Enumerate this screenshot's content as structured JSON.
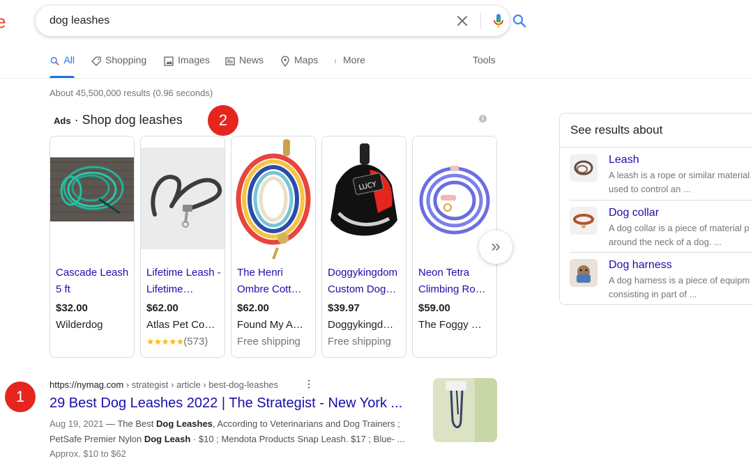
{
  "search": {
    "query": "dog leashes"
  },
  "tabs": [
    {
      "label": "All",
      "icon": "search-icon",
      "active": true
    },
    {
      "label": "Shopping",
      "icon": "tag-icon"
    },
    {
      "label": "Images",
      "icon": "image-icon"
    },
    {
      "label": "News",
      "icon": "news-icon"
    },
    {
      "label": "Maps",
      "icon": "map-pin-icon"
    },
    {
      "label": "More",
      "icon": "more-vert-icon"
    }
  ],
  "tools_label": "Tools",
  "result_stats": "About 45,500,000 results (0.96 seconds)",
  "ads": {
    "label": "Ads",
    "separator": "·",
    "title": "Shop dog leashes",
    "info_glyph": "i",
    "products": [
      {
        "title": "Cascade Leash 5 ft",
        "price": "$32.00",
        "merchant": "Wilderdog",
        "extra": ""
      },
      {
        "title": "Lifetime Leash - Lifetime…",
        "price": "$62.00",
        "merchant": "Atlas Pet Co…",
        "stars": "★★★★★",
        "extra": "(573)"
      },
      {
        "title": "The Henri Ombre Cott…",
        "price": "$62.00",
        "merchant": "Found My A…",
        "extra": "Free shipping"
      },
      {
        "title": "Doggykingdom Custom Dog…",
        "price": "$39.97",
        "merchant": "Doggykingd…",
        "extra": "Free shipping"
      },
      {
        "title": "Neon Tetra Climbing Ro…",
        "price": "$59.00",
        "merchant": "The Foggy …",
        "extra": ""
      }
    ],
    "next_glyph": "»"
  },
  "badges": {
    "one": "1",
    "two": "2"
  },
  "organic": {
    "site": "https://nymag.com",
    "path": " › strategist › article › best-dog-leashes",
    "menu_glyph": "⋮",
    "title": "29 Best Dog Leashes 2022 | The Strategist - New York ...",
    "snippet_date": "Aug 19, 2021",
    "snippet_dash": " — ",
    "snippet_1": "The Best ",
    "snippet_bold_1": "Dog Leashes",
    "snippet_2": ", According to Veterinarians and Dog Trainers ; PetSafe Premier Nylon ",
    "snippet_bold_2": "Dog Leash",
    "snippet_3": " · $10 ; Mendota Products Snap Leash. $17 ; Blue- ...",
    "extra": "Approx. $10 to $62"
  },
  "knowledge": {
    "title": "See results about",
    "items": [
      {
        "name": "Leash",
        "desc": "A leash is a rope or similar material\nused to control an ..."
      },
      {
        "name": "Dog collar",
        "desc": "A dog collar is a piece of material p\naround the neck of a dog. ..."
      },
      {
        "name": "Dog harness",
        "desc": "A dog harness is a piece of equipm\nconsisting in part of ..."
      }
    ]
  },
  "logo_fragment": "e"
}
